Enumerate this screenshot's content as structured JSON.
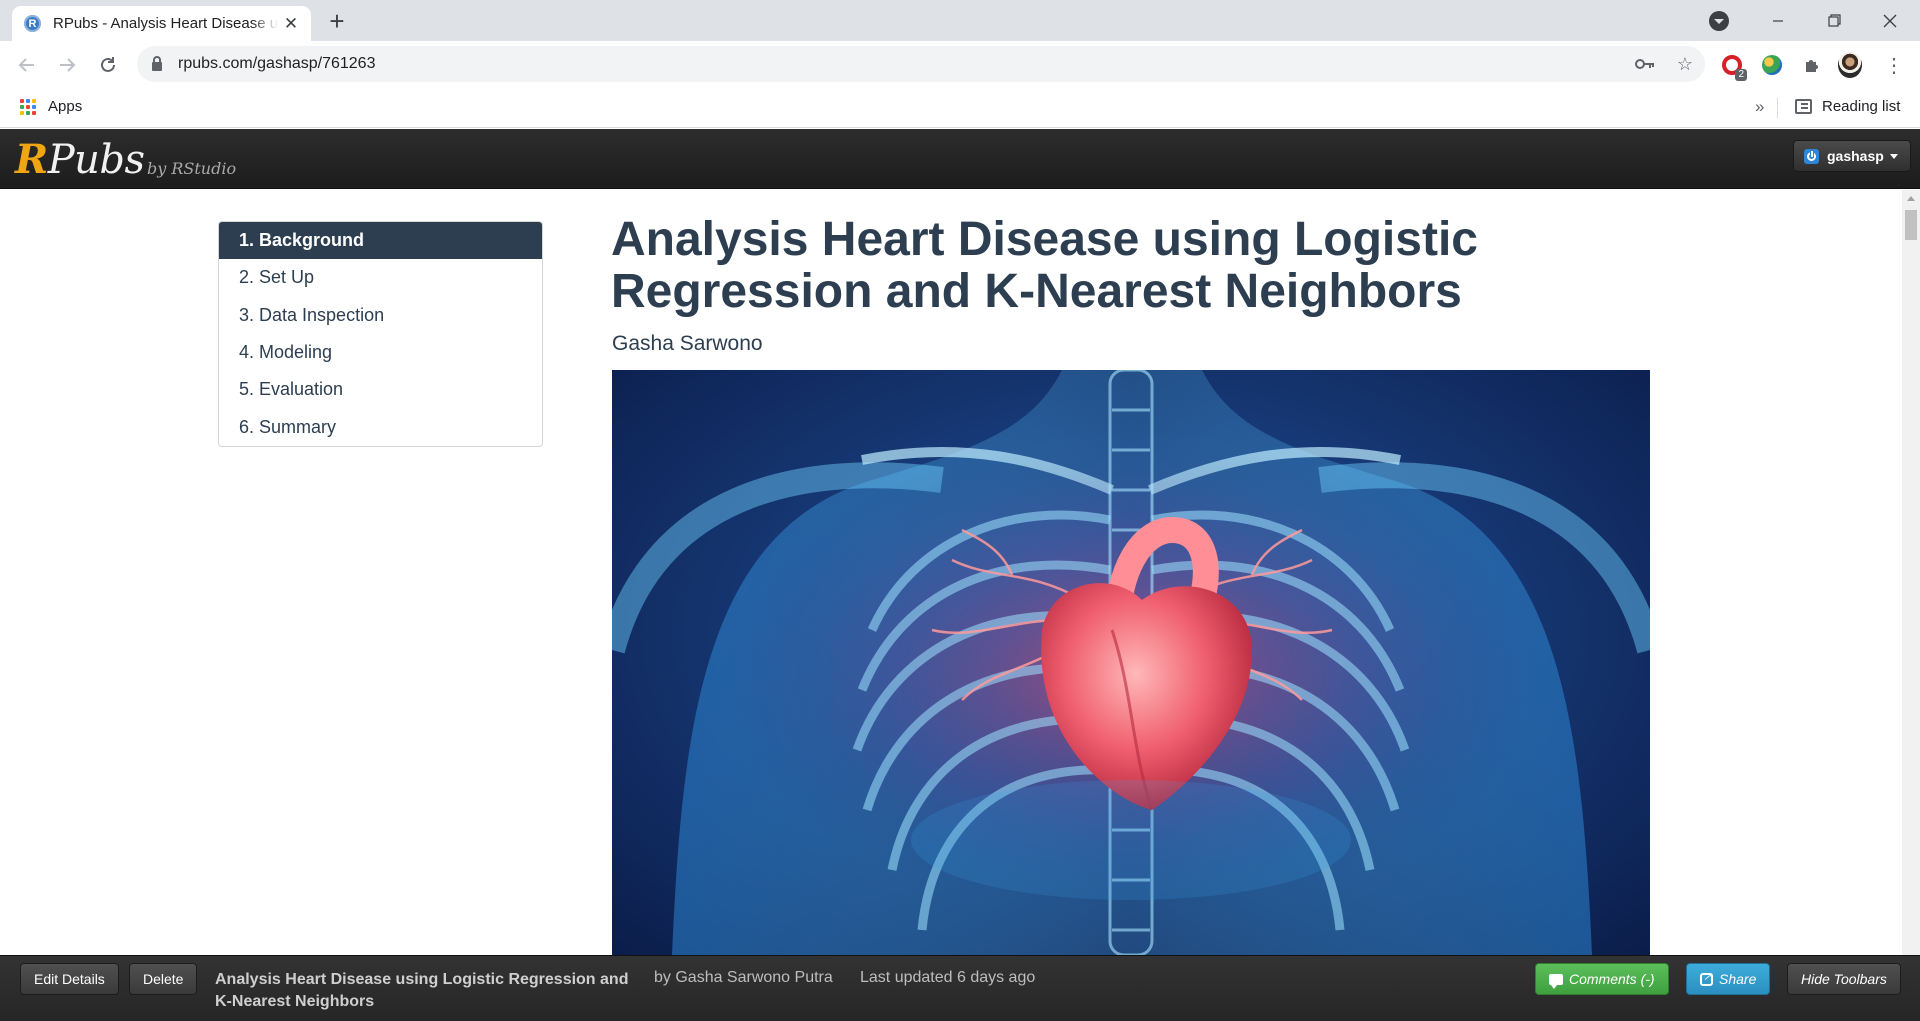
{
  "browser": {
    "tab_title": "RPubs - Analysis Heart Disease using Logistic Regression and K-Nearest Neighbors",
    "favicon_letter": "R",
    "url": "rpubs.com/gashasp/761263",
    "bookmarks_apps_label": "Apps",
    "reading_list_label": "Reading list",
    "extension_badge_count": "2",
    "icons": [
      "back-icon",
      "forward-icon",
      "reload-icon",
      "lock-icon",
      "key-icon",
      "star-icon",
      "opera-extension-icon",
      "globe-extension-icon",
      "puzzle-extension-icon",
      "profile-avatar-icon",
      "kebab-menu-icon",
      "tab-search-icon",
      "minimize-icon",
      "restore-icon",
      "close-window-icon"
    ]
  },
  "rpubs": {
    "logo_r": "R",
    "logo_rest": "Pubs",
    "by_line": "by RStudio",
    "username": "gashasp"
  },
  "toc": [
    {
      "label": "1. Background",
      "active": true
    },
    {
      "label": "2. Set Up",
      "active": false
    },
    {
      "label": "3. Data Inspection",
      "active": false
    },
    {
      "label": "4. Modeling",
      "active": false
    },
    {
      "label": "5. Evaluation",
      "active": false
    },
    {
      "label": "6. Summary",
      "active": false
    }
  ],
  "document": {
    "title": "Analysis Heart Disease using Logistic Regression and K-Nearest Neighbors",
    "author": "Gasha Sarwono"
  },
  "bottom_bar": {
    "edit_details": "Edit Details",
    "delete": "Delete",
    "doc_title": "Analysis Heart Disease using Logistic Regression and K-Nearest Neighbors",
    "by_author": "by Gasha Sarwono Putra",
    "last_updated": "Last updated 6 days ago",
    "comments": "Comments (-)",
    "share": "Share",
    "hide_toolbars": "Hide Toolbars"
  },
  "colors": {
    "rpubs_accent": "#f0a513",
    "toc_active": "#2c3e50",
    "comments_button": "#4cae4c",
    "share_button": "#2f9fd0"
  }
}
